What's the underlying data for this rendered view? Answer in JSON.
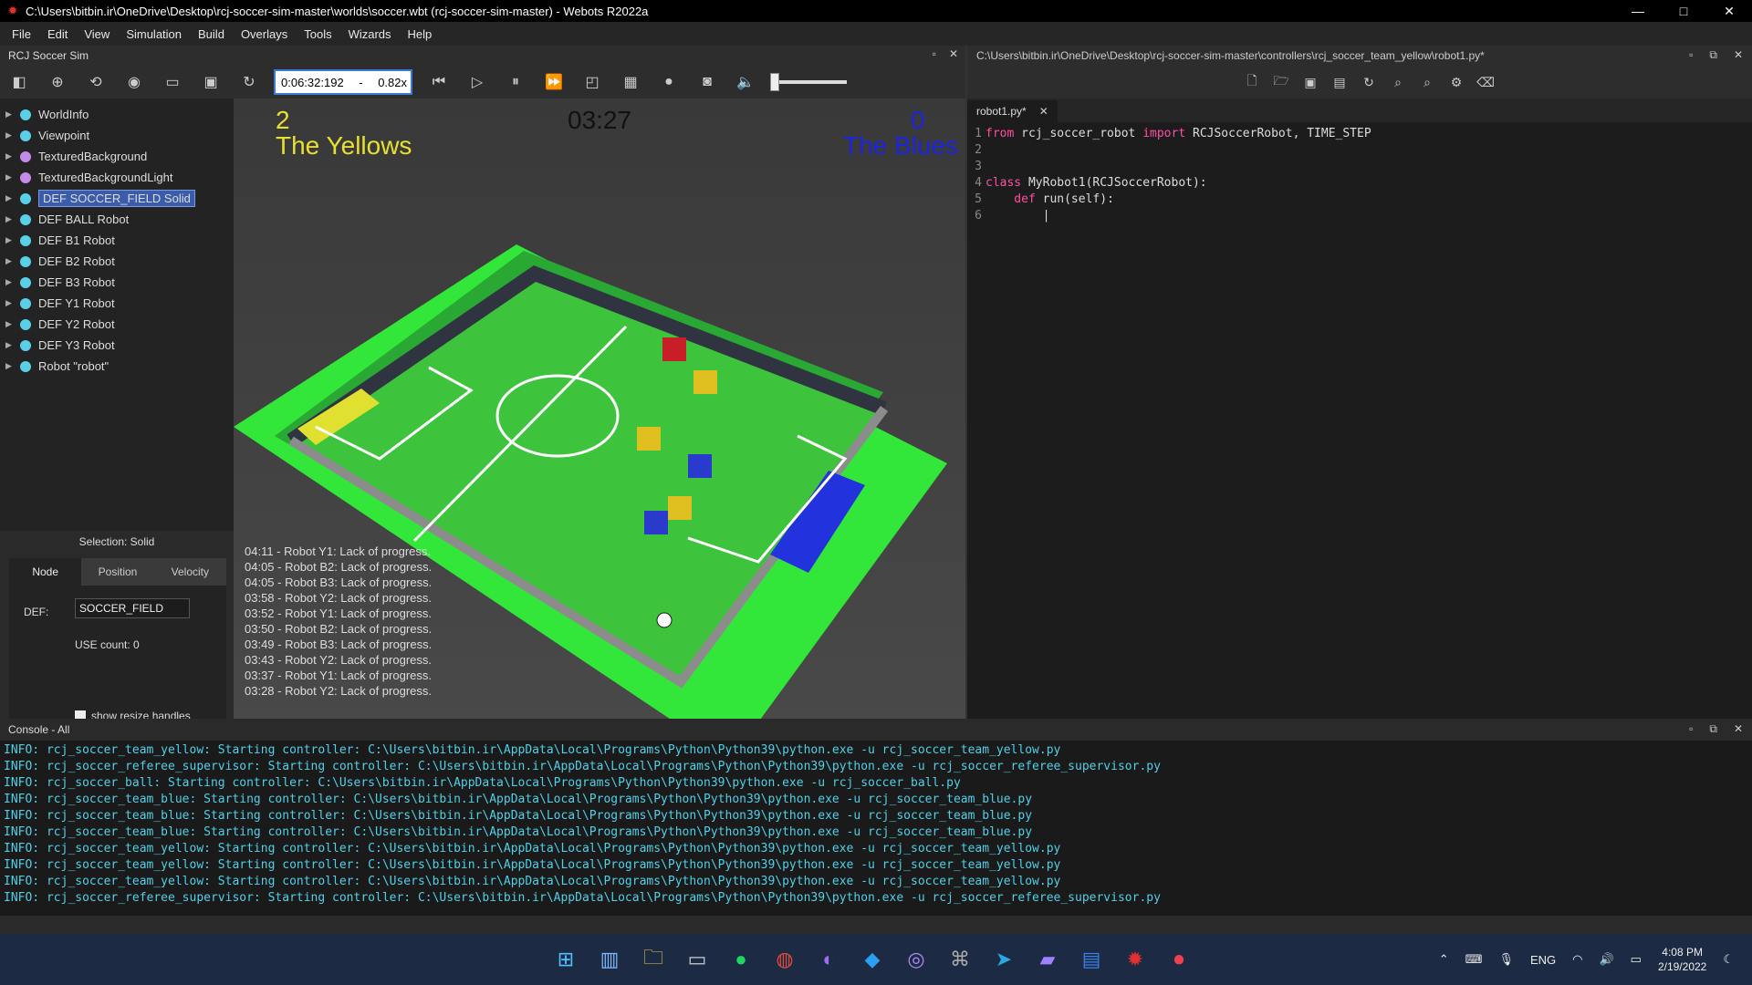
{
  "window": {
    "title": "C:\\Users\\bitbin.ir\\OneDrive\\Desktop\\rcj-soccer-sim-master\\worlds\\soccer.wbt (rcj-soccer-sim-master) - Webots R2022a",
    "minimize": "—",
    "maximize": "□",
    "close": "✕"
  },
  "menu": [
    "File",
    "Edit",
    "View",
    "Simulation",
    "Build",
    "Overlays",
    "Tools",
    "Wizards",
    "Help"
  ],
  "sim_panel": {
    "title": "RCJ Soccer Sim",
    "time": "0:06:32:192",
    "dash": "-",
    "speed": "0.82x"
  },
  "scene_tree": [
    {
      "label": "WorldInfo",
      "color": "#5ad0e8"
    },
    {
      "label": "Viewpoint",
      "color": "#5ad0e8"
    },
    {
      "label": "TexturedBackground",
      "color": "#c58be8"
    },
    {
      "label": "TexturedBackgroundLight",
      "color": "#c58be8"
    },
    {
      "label": "DEF SOCCER_FIELD Solid",
      "color": "#5ad0e8"
    },
    {
      "label": "DEF BALL Robot",
      "color": "#5ad0e8"
    },
    {
      "label": "DEF B1 Robot",
      "color": "#5ad0e8"
    },
    {
      "label": "DEF B2 Robot",
      "color": "#5ad0e8"
    },
    {
      "label": "DEF B3 Robot",
      "color": "#5ad0e8"
    },
    {
      "label": "DEF Y1 Robot",
      "color": "#5ad0e8"
    },
    {
      "label": "DEF Y2 Robot",
      "color": "#5ad0e8"
    },
    {
      "label": "DEF Y3 Robot",
      "color": "#5ad0e8"
    },
    {
      "label": "Robot \"robot\"",
      "color": "#5ad0e8"
    }
  ],
  "properties": {
    "selection": "Selection: Solid",
    "tabs": [
      "Node",
      "Position",
      "Velocity"
    ],
    "def_label": "DEF:",
    "def_value": "SOCCER_FIELD",
    "use_count": "USE count: 0",
    "resize": "show resize handles"
  },
  "scoreboard": {
    "yellow_score": "2",
    "yellow_name": "The Yellows",
    "clock": "03:27",
    "blue_score": "0",
    "blue_name": "The Blues"
  },
  "event_log": [
    "04:11 - Robot Y1: Lack of progress.",
    "04:05 - Robot B2: Lack of progress.",
    "04:05 - Robot B3: Lack of progress.",
    "03:58 - Robot Y2: Lack of progress.",
    "03:52 - Robot Y1: Lack of progress.",
    "03:50 - Robot B2: Lack of progress.",
    "03:49 - Robot B3: Lack of progress.",
    "03:43 - Robot Y2: Lack of progress.",
    "03:37 - Robot Y1: Lack of progress.",
    "03:28 - Robot Y2: Lack of progress."
  ],
  "editor": {
    "path": "C:\\Users\\bitbin.ir\\OneDrive\\Desktop\\rcj-soccer-sim-master\\controllers\\rcj_soccer_team_yellow\\robot1.py*",
    "tab": "robot1.py*",
    "tab_close": "✕",
    "lines": [
      {
        "n": "1",
        "kw": "from",
        "t1": " rcj_soccer_robot ",
        "kw2": "import",
        "t2": " RCJSoccerRobot, TIME_STEP"
      },
      {
        "n": "2",
        "kw": "",
        "t1": "",
        "kw2": "",
        "t2": ""
      },
      {
        "n": "3",
        "kw": "",
        "t1": "",
        "kw2": "",
        "t2": ""
      },
      {
        "n": "4",
        "kw": "class",
        "t1": " MyRobot1(RCJSoccerRobot):",
        "kw2": "",
        "t2": ""
      },
      {
        "n": "5",
        "kw": "    def",
        "t1": " run(self):",
        "kw2": "",
        "t2": ""
      },
      {
        "n": "6",
        "kw": "",
        "t1": "        |",
        "kw2": "",
        "t2": ""
      }
    ]
  },
  "console": {
    "title": "Console - All",
    "lines": [
      "INFO: rcj_soccer_team_yellow: Starting controller: C:\\Users\\bitbin.ir\\AppData\\Local\\Programs\\Python\\Python39\\python.exe -u rcj_soccer_team_yellow.py",
      "INFO: rcj_soccer_referee_supervisor: Starting controller: C:\\Users\\bitbin.ir\\AppData\\Local\\Programs\\Python\\Python39\\python.exe -u rcj_soccer_referee_supervisor.py",
      "INFO: rcj_soccer_ball: Starting controller: C:\\Users\\bitbin.ir\\AppData\\Local\\Programs\\Python\\Python39\\python.exe -u rcj_soccer_ball.py",
      "INFO: rcj_soccer_team_blue: Starting controller: C:\\Users\\bitbin.ir\\AppData\\Local\\Programs\\Python\\Python39\\python.exe -u rcj_soccer_team_blue.py",
      "INFO: rcj_soccer_team_blue: Starting controller: C:\\Users\\bitbin.ir\\AppData\\Local\\Programs\\Python\\Python39\\python.exe -u rcj_soccer_team_blue.py",
      "INFO: rcj_soccer_team_blue: Starting controller: C:\\Users\\bitbin.ir\\AppData\\Local\\Programs\\Python\\Python39\\python.exe -u rcj_soccer_team_blue.py",
      "INFO: rcj_soccer_team_yellow: Starting controller: C:\\Users\\bitbin.ir\\AppData\\Local\\Programs\\Python\\Python39\\python.exe -u rcj_soccer_team_yellow.py",
      "INFO: rcj_soccer_team_yellow: Starting controller: C:\\Users\\bitbin.ir\\AppData\\Local\\Programs\\Python\\Python39\\python.exe -u rcj_soccer_team_yellow.py",
      "INFO: rcj_soccer_team_yellow: Starting controller: C:\\Users\\bitbin.ir\\AppData\\Local\\Programs\\Python\\Python39\\python.exe -u rcj_soccer_team_yellow.py",
      "INFO: rcj_soccer_referee_supervisor: Starting controller: C:\\Users\\bitbin.ir\\AppData\\Local\\Programs\\Python\\Python39\\python.exe -u rcj_soccer_referee_supervisor.py"
    ]
  },
  "taskbar": {
    "lang": "ENG",
    "time": "4:08 PM",
    "date": "2/19/2022"
  }
}
